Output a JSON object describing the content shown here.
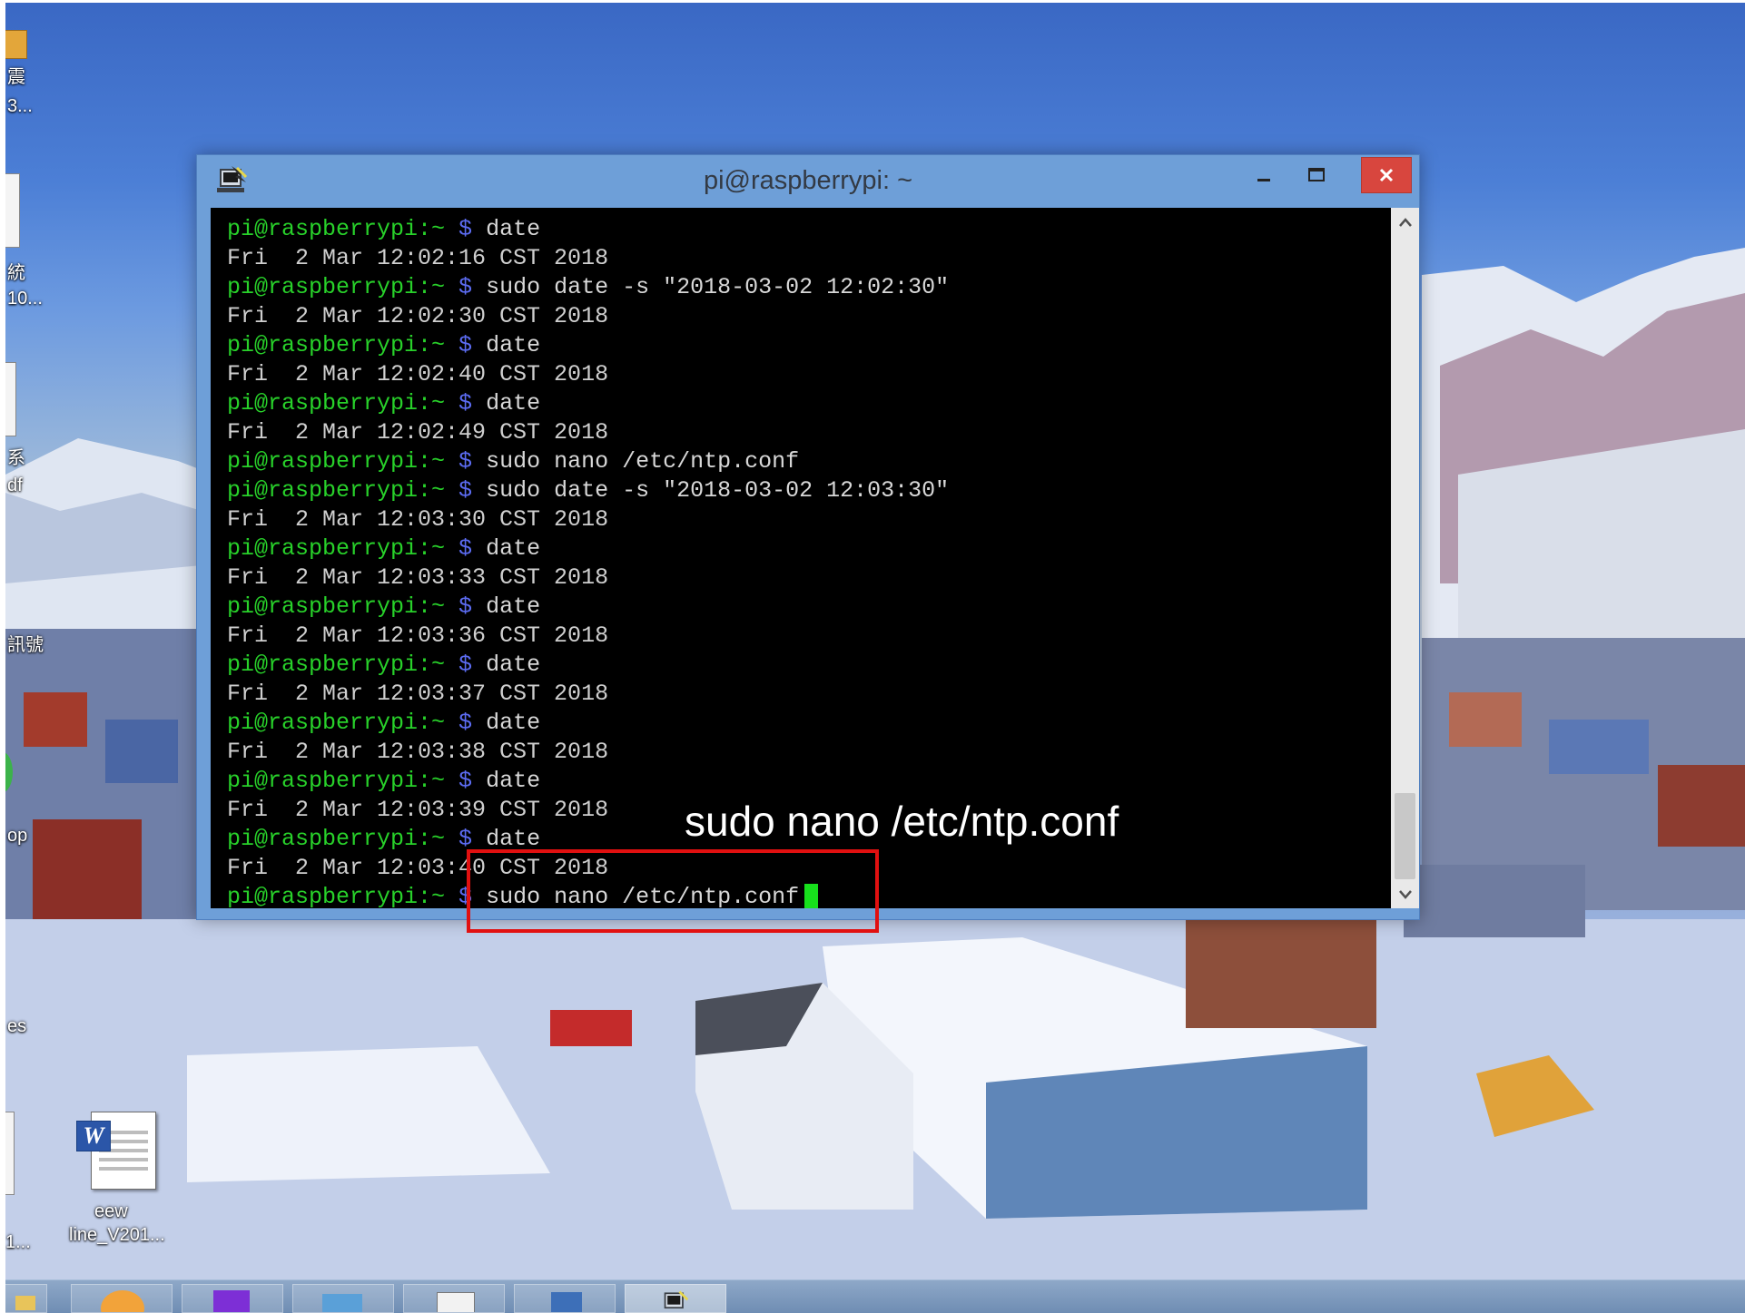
{
  "window": {
    "title": "pi@raspberrypi: ~"
  },
  "terminal": {
    "lines": [
      {
        "type": "input",
        "user": "pi@raspberrypi:~ ",
        "dollar": "$ ",
        "cmd": "date"
      },
      {
        "type": "output",
        "text": "Fri  2 Mar 12:02:16 CST 2018"
      },
      {
        "type": "input",
        "user": "pi@raspberrypi:~ ",
        "dollar": "$ ",
        "cmd": "sudo date -s \"2018-03-02 12:02:30\""
      },
      {
        "type": "output",
        "text": "Fri  2 Mar 12:02:30 CST 2018"
      },
      {
        "type": "input",
        "user": "pi@raspberrypi:~ ",
        "dollar": "$ ",
        "cmd": "date"
      },
      {
        "type": "output",
        "text": "Fri  2 Mar 12:02:40 CST 2018"
      },
      {
        "type": "input",
        "user": "pi@raspberrypi:~ ",
        "dollar": "$ ",
        "cmd": "date"
      },
      {
        "type": "output",
        "text": "Fri  2 Mar 12:02:49 CST 2018"
      },
      {
        "type": "input",
        "user": "pi@raspberrypi:~ ",
        "dollar": "$ ",
        "cmd": "sudo nano /etc/ntp.conf"
      },
      {
        "type": "input",
        "user": "pi@raspberrypi:~ ",
        "dollar": "$ ",
        "cmd": "sudo date -s \"2018-03-02 12:03:30\""
      },
      {
        "type": "output",
        "text": "Fri  2 Mar 12:03:30 CST 2018"
      },
      {
        "type": "input",
        "user": "pi@raspberrypi:~ ",
        "dollar": "$ ",
        "cmd": "date"
      },
      {
        "type": "output",
        "text": "Fri  2 Mar 12:03:33 CST 2018"
      },
      {
        "type": "input",
        "user": "pi@raspberrypi:~ ",
        "dollar": "$ ",
        "cmd": "date"
      },
      {
        "type": "output",
        "text": "Fri  2 Mar 12:03:36 CST 2018"
      },
      {
        "type": "input",
        "user": "pi@raspberrypi:~ ",
        "dollar": "$ ",
        "cmd": "date"
      },
      {
        "type": "output",
        "text": "Fri  2 Mar 12:03:37 CST 2018"
      },
      {
        "type": "input",
        "user": "pi@raspberrypi:~ ",
        "dollar": "$ ",
        "cmd": "date"
      },
      {
        "type": "output",
        "text": "Fri  2 Mar 12:03:38 CST 2018"
      },
      {
        "type": "input",
        "user": "pi@raspberrypi:~ ",
        "dollar": "$ ",
        "cmd": "date"
      },
      {
        "type": "output",
        "text": "Fri  2 Mar 12:03:39 CST 2018"
      },
      {
        "type": "input",
        "user": "pi@raspberrypi:~ ",
        "dollar": "$ ",
        "cmd": "date"
      },
      {
        "type": "output",
        "text": "Fri  2 Mar 12:03:40 CST 2018"
      },
      {
        "type": "input",
        "user": "pi@raspberrypi:~ ",
        "dollar": "$ ",
        "cmd": "sudo nano /etc/ntp.conf",
        "cursor": true
      }
    ]
  },
  "annotation": {
    "text": "sudo nano /etc/ntp.conf",
    "color": "#e11010"
  },
  "desktop_icons": [
    {
      "label": "震"
    },
    {
      "label": "3..."
    },
    {
      "label": "統"
    },
    {
      "label": "10..."
    },
    {
      "label": "系"
    },
    {
      "label": "df"
    },
    {
      "label": "訊號"
    },
    {
      "label": "op"
    },
    {
      "label": "es"
    },
    {
      "label": "1..."
    },
    {
      "label": "eew"
    },
    {
      "label": "line_V201..."
    }
  ],
  "colors": {
    "prompt_user": "#28d12a",
    "prompt_dollar": "#5c6cf2",
    "cursor": "#17e01c",
    "close_button": "#d8463e"
  }
}
